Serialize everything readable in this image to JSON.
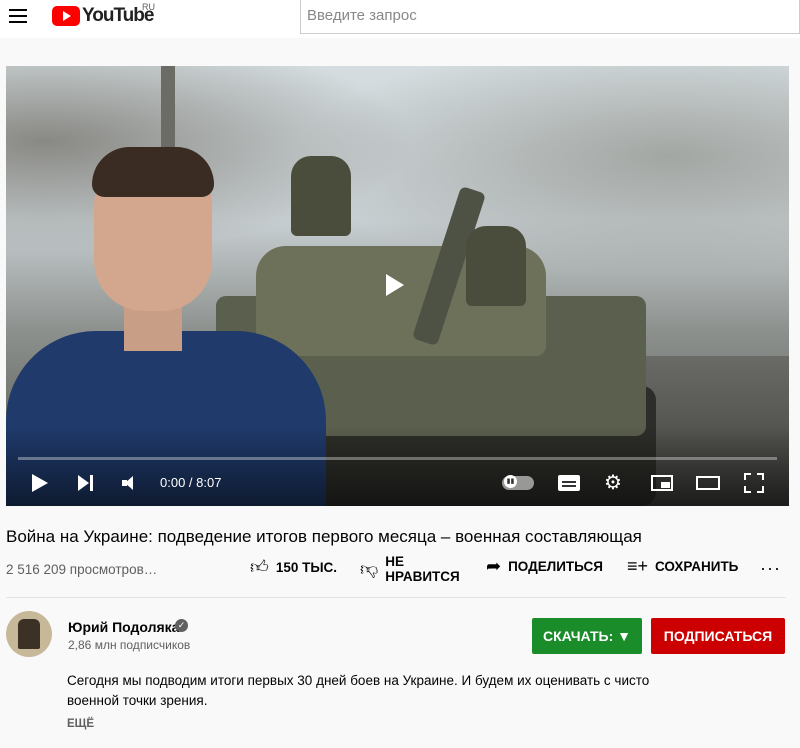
{
  "header": {
    "logo_text": "YouTube",
    "region": "RU",
    "search_placeholder": "Введите запрос"
  },
  "player": {
    "time": "0:00 / 8:07",
    "progress_fraction": 0.0
  },
  "video": {
    "title": "Война на Украине: подведение итогов первого месяца – военная составляющая",
    "views": "2 516 209 просмотров…",
    "actions": {
      "like_count": "150 ТЫС.",
      "dislike_line1": "НЕ",
      "dislike_line2": "НРАВИТСЯ",
      "share": "ПОДЕЛИТЬСЯ",
      "save": "СОХРАНИТЬ",
      "more": "···"
    }
  },
  "channel": {
    "name": "Юрий Подоляка",
    "subscribers": "2,86 млн подписчиков",
    "download_label": "СКАЧАТЬ: ▼",
    "subscribe_label": "ПОДПИСАТЬСЯ",
    "download_color": "#1a8c2a",
    "subscribe_color": "#cc0000"
  },
  "description": {
    "text": "Сегодня мы подводим итоги первых 30 дней боев на Украине. И будем их оценивать с чисто военной точки зрения.",
    "more_label": "ЕЩЁ"
  }
}
